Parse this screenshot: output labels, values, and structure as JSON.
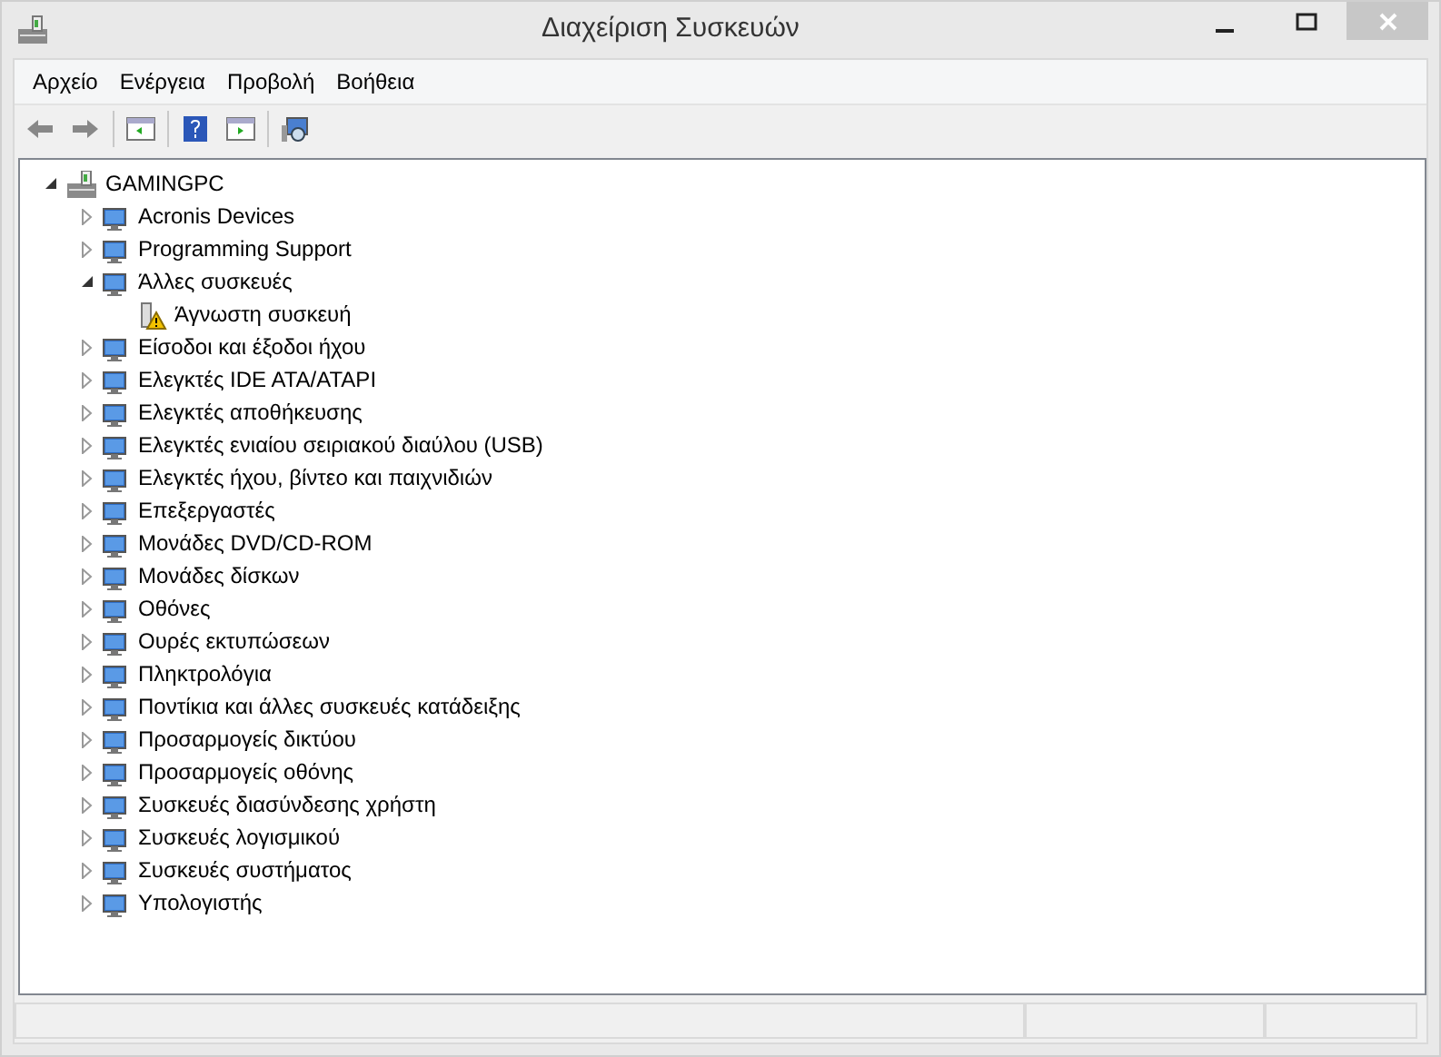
{
  "window": {
    "title": "Διαχείριση Συσκευών"
  },
  "menu": [
    "Αρχείο",
    "Ενέργεια",
    "Προβολή",
    "Βοήθεια"
  ],
  "tree": {
    "label": "GAMINGPC",
    "expanded": true,
    "children": [
      {
        "label": "Acronis Devices",
        "expanded": false
      },
      {
        "label": "Programming Support",
        "expanded": false
      },
      {
        "label": "Άλλες συσκευές",
        "expanded": true,
        "children": [
          {
            "label": "Άγνωστη συσκευή",
            "warning": true
          }
        ]
      },
      {
        "label": "Είσοδοι και έξοδοι ήχου",
        "expanded": false
      },
      {
        "label": "Ελεγκτές IDE ATA/ATAPI",
        "expanded": false
      },
      {
        "label": "Ελεγκτές αποθήκευσης",
        "expanded": false
      },
      {
        "label": "Ελεγκτές ενιαίου σειριακού διαύλου (USB)",
        "expanded": false
      },
      {
        "label": "Ελεγκτές ήχου, βίντεο και παιχνιδιών",
        "expanded": false
      },
      {
        "label": "Επεξεργαστές",
        "expanded": false
      },
      {
        "label": "Μονάδες DVD/CD-ROM",
        "expanded": false
      },
      {
        "label": "Μονάδες δίσκων",
        "expanded": false
      },
      {
        "label": "Οθόνες",
        "expanded": false
      },
      {
        "label": "Ουρές εκτυπώσεων",
        "expanded": false
      },
      {
        "label": "Πληκτρολόγια",
        "expanded": false
      },
      {
        "label": "Ποντίκια και άλλες συσκευές κατάδειξης",
        "expanded": false
      },
      {
        "label": "Προσαρμογείς δικτύου",
        "expanded": false
      },
      {
        "label": "Προσαρμογείς οθόνης",
        "expanded": false
      },
      {
        "label": "Συσκευές διασύνδεσης χρήστη",
        "expanded": false
      },
      {
        "label": "Συσκευές λογισμικού",
        "expanded": false
      },
      {
        "label": "Συσκευές συστήματος",
        "expanded": false
      },
      {
        "label": "Υπολογιστής",
        "expanded": false
      }
    ]
  }
}
